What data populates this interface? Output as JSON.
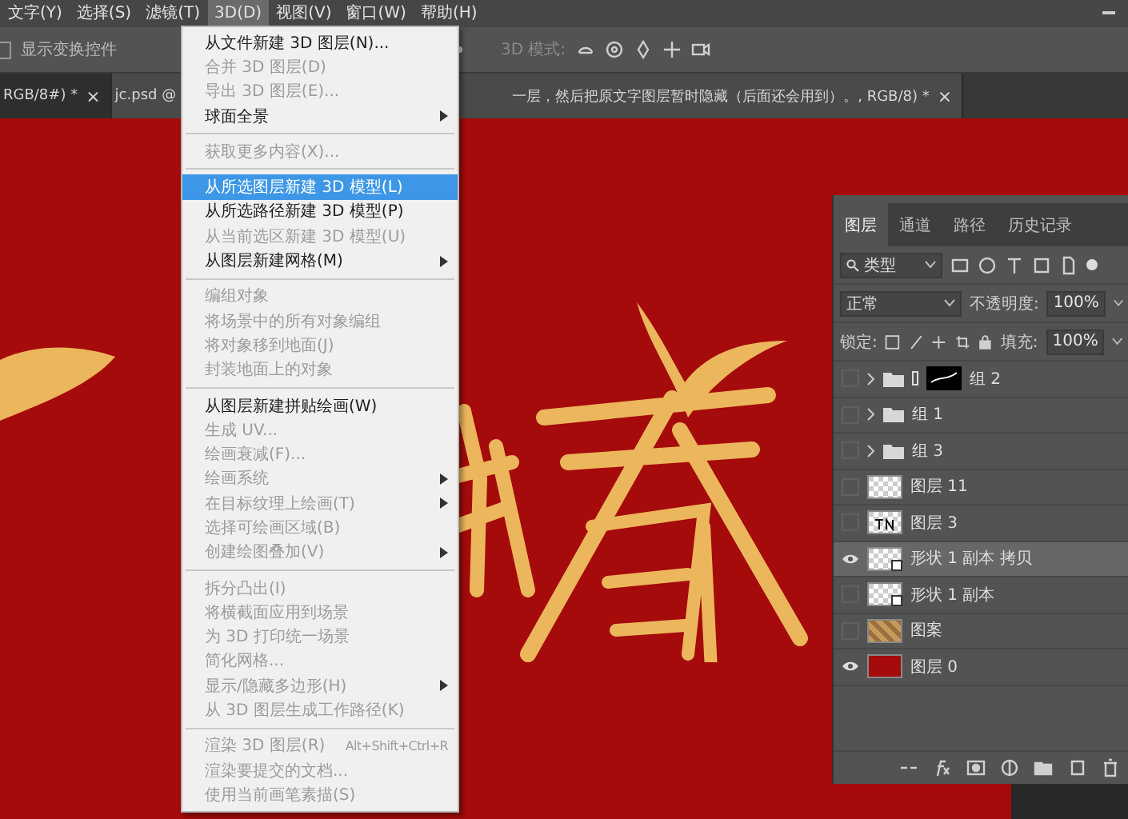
{
  "menubar": {
    "items": [
      {
        "label": "文字(Y)",
        "selected": false
      },
      {
        "label": "选择(S)",
        "selected": false
      },
      {
        "label": "滤镜(T)",
        "selected": false
      },
      {
        "label": "3D(D)",
        "selected": true
      },
      {
        "label": "视图(V)",
        "selected": false
      },
      {
        "label": "窗口(W)",
        "selected": false
      },
      {
        "label": "帮助(H)",
        "selected": false
      }
    ]
  },
  "options_bar": {
    "transform_controls": {
      "label": "显示变换控件",
      "checked": false
    },
    "mode_label": "3D 模式:"
  },
  "document_tabs": [
    {
      "title_start": "RGB/8#) *",
      "close": "×",
      "selected": false
    },
    {
      "title_start": "jc.psd @",
      "title_end": "一层，然后把原文字图层暂时隐藏（后面还会用到）。, RGB/8) *",
      "close": "×",
      "selected": true
    }
  ],
  "menu": {
    "sections": [
      [
        {
          "label": "从文件新建 3D 图层(N)...",
          "disabled": false,
          "selected": false,
          "submenu": false
        },
        {
          "label": "合并 3D 图层(D)",
          "disabled": true,
          "selected": false,
          "submenu": false
        },
        {
          "label": "导出 3D 图层(E)...",
          "disabled": true,
          "selected": false,
          "submenu": false
        },
        {
          "label": "球面全景",
          "disabled": false,
          "selected": false,
          "submenu": true
        }
      ],
      [
        {
          "label": "获取更多内容(X)...",
          "disabled": true,
          "selected": false,
          "submenu": false
        }
      ],
      [
        {
          "label": "从所选图层新建 3D 模型(L)",
          "disabled": false,
          "selected": true,
          "submenu": false
        },
        {
          "label": "从所选路径新建 3D 模型(P)",
          "disabled": false,
          "selected": false,
          "submenu": false
        },
        {
          "label": "从当前选区新建 3D 模型(U)",
          "disabled": true,
          "selected": false,
          "submenu": false
        },
        {
          "label": "从图层新建网格(M)",
          "disabled": false,
          "selected": false,
          "submenu": true
        }
      ],
      [
        {
          "label": "编组对象",
          "disabled": true,
          "selected": false,
          "submenu": false
        },
        {
          "label": "将场景中的所有对象编组",
          "disabled": true,
          "selected": false,
          "submenu": false
        },
        {
          "label": "将对象移到地面(J)",
          "disabled": true,
          "selected": false,
          "submenu": false
        },
        {
          "label": "封装地面上的对象",
          "disabled": true,
          "selected": false,
          "submenu": false
        }
      ],
      [
        {
          "label": "从图层新建拼贴绘画(W)",
          "disabled": false,
          "selected": false,
          "submenu": false
        },
        {
          "label": "生成 UV...",
          "disabled": true,
          "selected": false,
          "submenu": false
        },
        {
          "label": "绘画衰减(F)...",
          "disabled": true,
          "selected": false,
          "submenu": false
        },
        {
          "label": "绘画系统",
          "disabled": true,
          "selected": false,
          "submenu": true
        },
        {
          "label": "在目标纹理上绘画(T)",
          "disabled": true,
          "selected": false,
          "submenu": true
        },
        {
          "label": "选择可绘画区域(B)",
          "disabled": true,
          "selected": false,
          "submenu": false
        },
        {
          "label": "创建绘图叠加(V)",
          "disabled": true,
          "selected": false,
          "submenu": true
        }
      ],
      [
        {
          "label": "拆分凸出(I)",
          "disabled": true,
          "selected": false,
          "submenu": false
        },
        {
          "label": "将横截面应用到场景",
          "disabled": true,
          "selected": false,
          "submenu": false
        },
        {
          "label": "为 3D 打印统一场景",
          "disabled": true,
          "selected": false,
          "submenu": false
        },
        {
          "label": "简化网格...",
          "disabled": true,
          "selected": false,
          "submenu": false
        },
        {
          "label": "显示/隐藏多边形(H)",
          "disabled": true,
          "selected": false,
          "submenu": true
        },
        {
          "label": "从 3D 图层生成工作路径(K)",
          "disabled": true,
          "selected": false,
          "submenu": false
        }
      ],
      [
        {
          "label": "渲染 3D 图层(R)",
          "shortcut": "Alt+Shift+Ctrl+R",
          "disabled": true,
          "selected": false,
          "submenu": false
        },
        {
          "label": "渲染要提交的文档...",
          "disabled": true,
          "selected": false,
          "submenu": false
        },
        {
          "label": "使用当前画笔素描(S)",
          "disabled": true,
          "selected": false,
          "submenu": false
        }
      ]
    ]
  },
  "layers_panel": {
    "tabs": [
      {
        "label": "图层",
        "selected": true
      },
      {
        "label": "通道",
        "selected": false
      },
      {
        "label": "路径",
        "selected": false
      },
      {
        "label": "历史记录",
        "selected": false
      }
    ],
    "filter": {
      "value": "类型"
    },
    "blend_mode": "正常",
    "opacity_label": "不透明度:",
    "opacity": "100%",
    "lock_label": "锁定:",
    "fill_label": "填充:",
    "fill": "100%",
    "layers": [
      {
        "name": "组 2",
        "kind": "group",
        "masked": true,
        "visible": false,
        "selected": false
      },
      {
        "name": "组 1",
        "kind": "group",
        "masked": false,
        "visible": false,
        "selected": false
      },
      {
        "name": "组 3",
        "kind": "group",
        "masked": false,
        "visible": false,
        "selected": false
      },
      {
        "name": "图层 11",
        "kind": "transparent",
        "visible": false,
        "selected": false
      },
      {
        "name": "图层 3",
        "kind": "text",
        "visible": false,
        "selected": false
      },
      {
        "name": "形状 1 副本 拷贝",
        "kind": "shape",
        "visible": true,
        "selected": true
      },
      {
        "name": "形状 1 副本",
        "kind": "shape",
        "visible": false,
        "selected": false
      },
      {
        "name": "图案",
        "kind": "pattern",
        "visible": false,
        "selected": false
      },
      {
        "name": "图层 0",
        "kind": "fill",
        "visible": true,
        "selected": false
      }
    ]
  }
}
